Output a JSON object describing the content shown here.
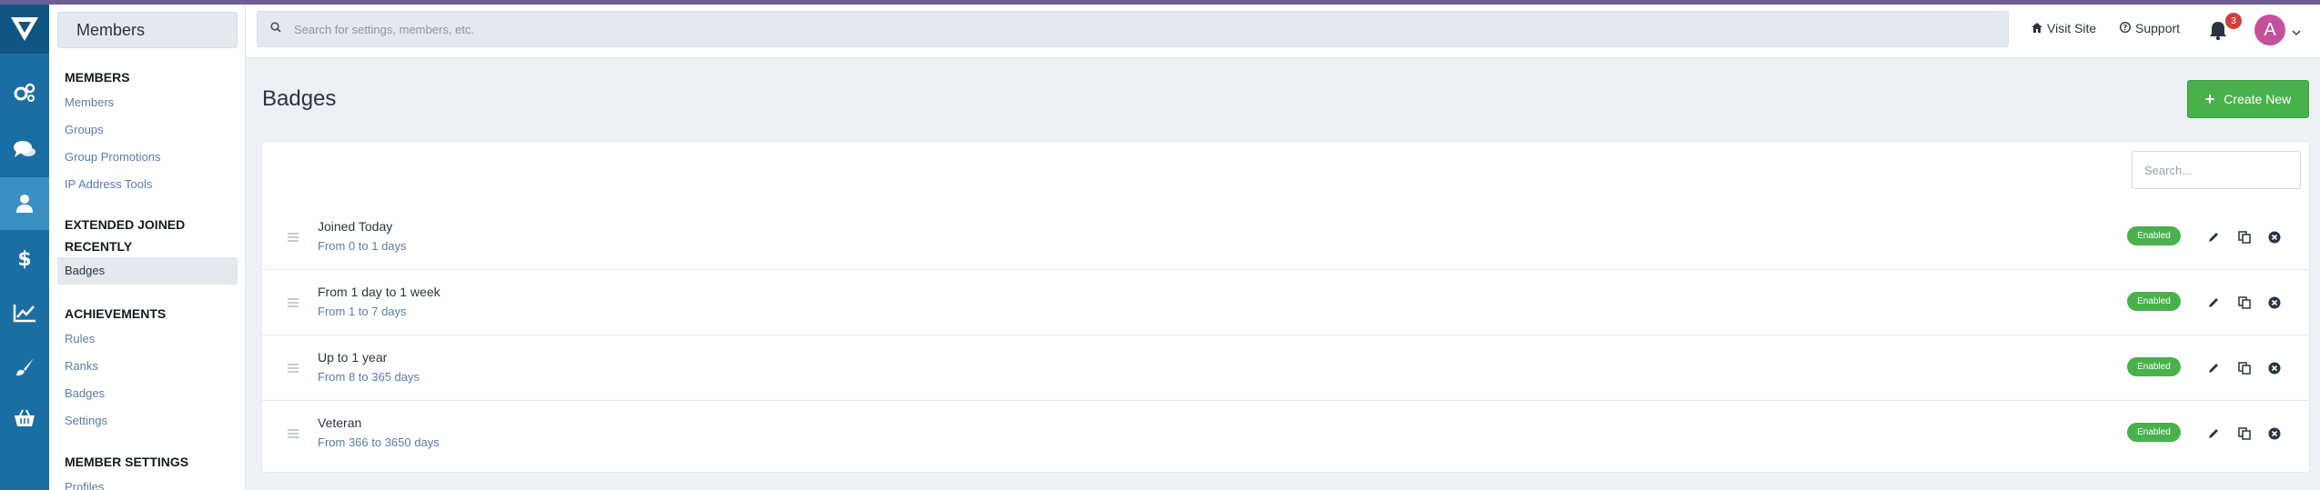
{
  "colors": {
    "accent": "#48b14c",
    "rail": "#1a6ea3",
    "rail_active": "#3b8fc4",
    "link": "#5a7cab",
    "avatar": "#c5509a"
  },
  "rail": {
    "icons": [
      "logo-icon",
      "gears-icon",
      "comments-icon",
      "user-icon",
      "dollar-icon",
      "chart-line-icon",
      "brush-icon",
      "basket-icon"
    ],
    "active": "user-icon"
  },
  "sidebar": {
    "heading": "Members",
    "sections": [
      {
        "title": "MEMBERS",
        "items": [
          "Members",
          "Groups",
          "Group Promotions",
          "IP Address Tools"
        ]
      },
      {
        "title": "EXTENDED JOINED RECENTLY",
        "items": [
          "Badges"
        ],
        "active": "Badges"
      },
      {
        "title": "ACHIEVEMENTS",
        "items": [
          "Rules",
          "Ranks",
          "Badges",
          "Settings"
        ]
      },
      {
        "title": "MEMBER SETTINGS",
        "items": [
          "Profiles"
        ]
      }
    ]
  },
  "topbar": {
    "search_placeholder": "Search for settings, members, etc.",
    "visit_site": "Visit Site",
    "support": "Support",
    "notifications_count": "3",
    "avatar_letter": "A"
  },
  "main": {
    "title": "Badges",
    "create_label": "Create New",
    "search_placeholder": "Search...",
    "rows": [
      {
        "title": "Joined Today",
        "subtitle": "From 0 to 1 days",
        "status": "Enabled"
      },
      {
        "title": "From 1 day to 1 week",
        "subtitle": "From 1 to 7 days",
        "status": "Enabled"
      },
      {
        "title": "Up to 1 year",
        "subtitle": "From 8 to 365 days",
        "status": "Enabled"
      },
      {
        "title": "Veteran",
        "subtitle": "From 366 to 3650 days",
        "status": "Enabled"
      }
    ]
  }
}
